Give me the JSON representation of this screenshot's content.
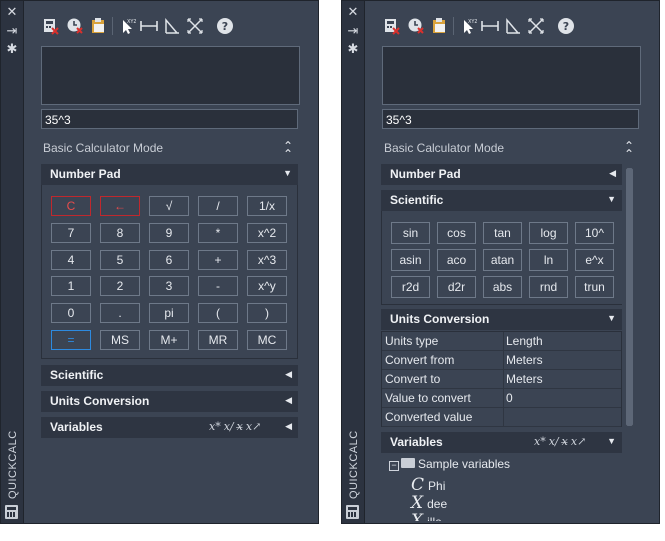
{
  "palette": {
    "chrome": "#3b4453",
    "side_strip": "#2c3340",
    "field_bg": "#2a303b",
    "section_header": "#2e3542",
    "key_border": "#6e7989",
    "clear_red": "#c0282d",
    "equals_blue": "#2d8ae0"
  },
  "palette_strip": {
    "title": "QUICKCALC",
    "close_glyph": "✕",
    "autohide_glyph": "⇥",
    "settings_glyph": "✱"
  },
  "toolbar": {
    "clear_icon": "clear-icon",
    "history_icon": "clear-history-icon",
    "paste_icon": "paste-to-command-line-icon",
    "point_icon": "get-coordinates-icon",
    "distance_icon": "distance-between-two-points-icon",
    "angle_icon": "angle-of-line-icon",
    "intersection_icon": "intersection-of-two-lines-icon",
    "help_label": "?"
  },
  "left": {
    "input_value": "35^3",
    "mode_label": "Basic Calculator Mode",
    "numpad_header": "Number Pad",
    "keys": [
      [
        "C",
        "←",
        "√",
        "/",
        "1/x"
      ],
      [
        "7",
        "8",
        "9",
        "*",
        "x^2"
      ],
      [
        "4",
        "5",
        "6",
        "+",
        "x^3"
      ],
      [
        "1",
        "2",
        "3",
        "-",
        "x^y"
      ],
      [
        "0",
        ".",
        "pi",
        "(",
        ")"
      ],
      [
        "=",
        "MS",
        "M+",
        "MR",
        "MC"
      ]
    ],
    "scientific_header": "Scientific",
    "units_header": "Units Conversion",
    "variables_header": "Variables"
  },
  "right": {
    "input_value": "35^3",
    "mode_label": "Basic Calculator Mode",
    "numpad_header": "Number Pad",
    "scientific_header": "Scientific",
    "sci_keys": [
      [
        "sin",
        "cos",
        "tan",
        "log",
        "10^"
      ],
      [
        "asin",
        "aco",
        "atan",
        "ln",
        "e^x"
      ],
      [
        "r2d",
        "d2r",
        "abs",
        "rnd",
        "trun"
      ]
    ],
    "units_header": "Units Conversion",
    "units": [
      {
        "key": "Units type",
        "value": "Length"
      },
      {
        "key": "Convert from",
        "value": "Meters"
      },
      {
        "key": "Convert to",
        "value": "Meters"
      },
      {
        "key": "Value to convert",
        "value": "0"
      },
      {
        "key": "Converted value",
        "value": ""
      }
    ],
    "variables_header": "Variables",
    "tree": {
      "root": "Sample variables",
      "items": [
        {
          "glyph": "C",
          "label": "Phi"
        },
        {
          "glyph": "X",
          "label": "dee"
        },
        {
          "glyph": "X",
          "label": "ille"
        }
      ]
    }
  },
  "variables_tools": [
    "new-variable-icon",
    "edit-variable-icon",
    "delete-variable-icon",
    "calculator-variable-icon"
  ]
}
